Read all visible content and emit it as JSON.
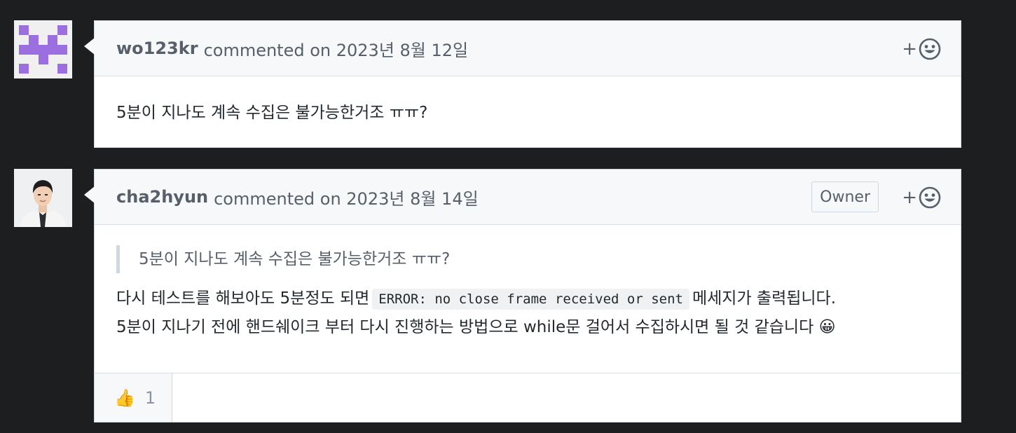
{
  "comments": [
    {
      "author": "wo123kr",
      "action_text": "commented on 2023년 8월 12일",
      "avatar_icon": "identicon-avatar",
      "avatar_color": "#9b6fe0",
      "add_reaction_label": "+",
      "body_lines": [
        "5분이 지나도 계속 수집은 불가능한거조 ㅠㅠ?"
      ]
    },
    {
      "author": "cha2hyun",
      "action_text": "commented on 2023년 8월 14일",
      "badge": "Owner",
      "avatar_icon": "profile-photo-avatar",
      "add_reaction_label": "+",
      "quote": "5분이 지나도 계속 수집은 불가능한거조 ㅠㅠ?",
      "line1_before": "다시 테스트를 해보아도 5분정도 되면",
      "line1_code": "ERROR: no close frame received or sent",
      "line1_after": "메세지가 출력됩니다.",
      "line2_text": "5분이 지나기 전에 핸드쉐이크 부터 다시 진행하는 방법으로 while문 걸어서 수집하시면 될 것 같습니다",
      "line2_emoji": "😀",
      "reactions": [
        {
          "emoji": "👍",
          "count": "1"
        }
      ]
    }
  ]
}
